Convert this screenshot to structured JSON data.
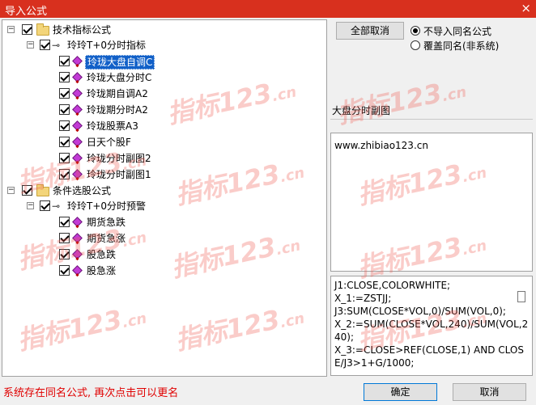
{
  "window": {
    "title": "导入公式",
    "close_glyph": "×"
  },
  "tree": {
    "groups": [
      {
        "label": "技术指标公式",
        "subgroup": {
          "label": "玲玲T+0分时指标",
          "items": [
            "玲珑大盘自调C",
            "玲珑大盘分时C",
            "玲珑期自调A2",
            "玲珑期分时A2",
            "玲珑股票A3",
            "日天个股F",
            "玲珑分时副图2",
            "玲珑分时副图1"
          ]
        }
      },
      {
        "label": "条件选股公式",
        "subgroup": {
          "label": "玲玲T+0分时预警",
          "items": [
            "期货急跌",
            "期货急涨",
            "股急跌",
            "股急涨"
          ]
        }
      }
    ],
    "selected_item": "玲珑大盘自调C",
    "expander_glyph": "−"
  },
  "buttons": {
    "cancel_all": "全部取消",
    "ok": "确定",
    "cancel": "取消"
  },
  "options": {
    "no_import_same": "不导入同名公式",
    "overwrite_same": "覆盖同名(非系统)",
    "selected": "no_import_same"
  },
  "detail": {
    "formula_name": "大盘分时副图",
    "description": "www.zhibiao123.cn",
    "code_lines": [
      "J1:CLOSE,COLORWHITE;",
      "X_1:=ZSTJJ;",
      "J3:SUM(CLOSE*VOL,0)/SUM(VOL,0);",
      "X_2:=SUM(CLOSE*VOL,240)/SUM(VOL,240);",
      "X_3:=CLOSE>REF(CLOSE,1) AND CLOSE/J3>1+G/1000;"
    ]
  },
  "status": {
    "message": "系统存在同名公式, 再次点击可以更名"
  },
  "watermark": {
    "text": "指标123",
    "suffix": ".cn"
  },
  "icons": {
    "folder": "folder-icon",
    "key": "key-icon",
    "formula": "formula-gem-icon",
    "check": "checkbox-checked-icon"
  },
  "colors": {
    "titlebar": "#d8301e",
    "selection": "#1160c8",
    "status_text": "#e00000",
    "watermark": "#f05a50"
  }
}
